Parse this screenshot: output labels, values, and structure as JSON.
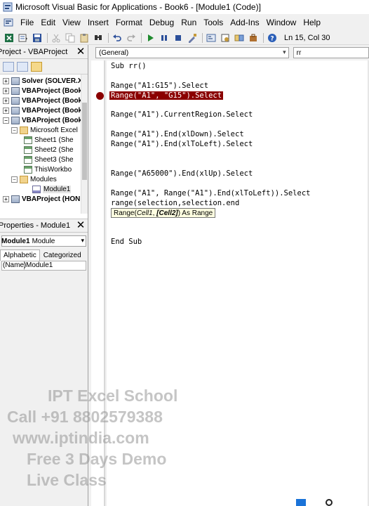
{
  "window": {
    "title": "Microsoft Visual Basic for Applications - Book6 - [Module1 (Code)]"
  },
  "menu": {
    "items": [
      {
        "label": "File"
      },
      {
        "label": "Edit"
      },
      {
        "label": "View"
      },
      {
        "label": "Insert"
      },
      {
        "label": "Format"
      },
      {
        "label": "Debug"
      },
      {
        "label": "Run"
      },
      {
        "label": "Tools"
      },
      {
        "label": "Add-Ins"
      },
      {
        "label": "Window"
      },
      {
        "label": "Help"
      }
    ]
  },
  "toolbar": {
    "position": "Ln 15, Col 30"
  },
  "project_pane": {
    "title": "Project - VBAProject",
    "close": "✕",
    "tree": [
      {
        "label": "Solver (SOLVER.X",
        "bold": true
      },
      {
        "label": "VBAProject (Book",
        "bold": true
      },
      {
        "label": "VBAProject (Book",
        "bold": true
      },
      {
        "label": "VBAProject (Book",
        "bold": true
      },
      {
        "label": "VBAProject (Book",
        "bold": true
      },
      {
        "label": "Microsoft Excel",
        "bold": false
      },
      {
        "label": "Sheet1 (She",
        "bold": false
      },
      {
        "label": "Sheet2 (She",
        "bold": false
      },
      {
        "label": "Sheet3 (She",
        "bold": false
      },
      {
        "label": "ThisWorkbo",
        "bold": false
      },
      {
        "label": "Modules",
        "bold": false
      },
      {
        "label": "Module1",
        "bold": false
      },
      {
        "label": "VBAProject (HONI",
        "bold": true
      }
    ]
  },
  "properties_pane": {
    "title": "Properties - Module1",
    "close": "✕",
    "object_name": "Module1",
    "object_type": "Module",
    "tabs": [
      {
        "label": "Alphabetic"
      },
      {
        "label": "Categorized"
      }
    ],
    "rows": [
      {
        "key": "(Name)",
        "value": "Module1"
      }
    ]
  },
  "code_window": {
    "object_combo": "(General)",
    "proc_combo": "rr",
    "lines": [
      "Sub rr()",
      "Range(\"A1:G15\").Select",
      "Range(\"A1\", \"G15\").Select",
      "Range(\"A1\").CurrentRegion.Select",
      "Range(\"A1\").End(xlDown).Select",
      "Range(\"A1\").End(xlToLeft).Select",
      "Range(\"A65000\").End(xlUp).Select",
      "Range(\"A1\", Range(\"A1\").End(xlToLeft)).Select",
      "range(selection,selection.end",
      "End Sub"
    ],
    "tooltip": {
      "prefix": "Range(",
      "arg1": "Cell1",
      "sep": ", ",
      "arg2": "[Cell2]",
      "suffix": ") As Range"
    }
  },
  "watermark": {
    "lines": [
      "IPT Excel School",
      "Call +91 8802579388",
      "www.iptindia.com",
      "Free 3 Days Demo",
      "Live Class"
    ]
  },
  "colors": {
    "breakpoint": "#8b0000",
    "keyword": "#00008b",
    "tooltip_bg": "#ffffe1"
  }
}
